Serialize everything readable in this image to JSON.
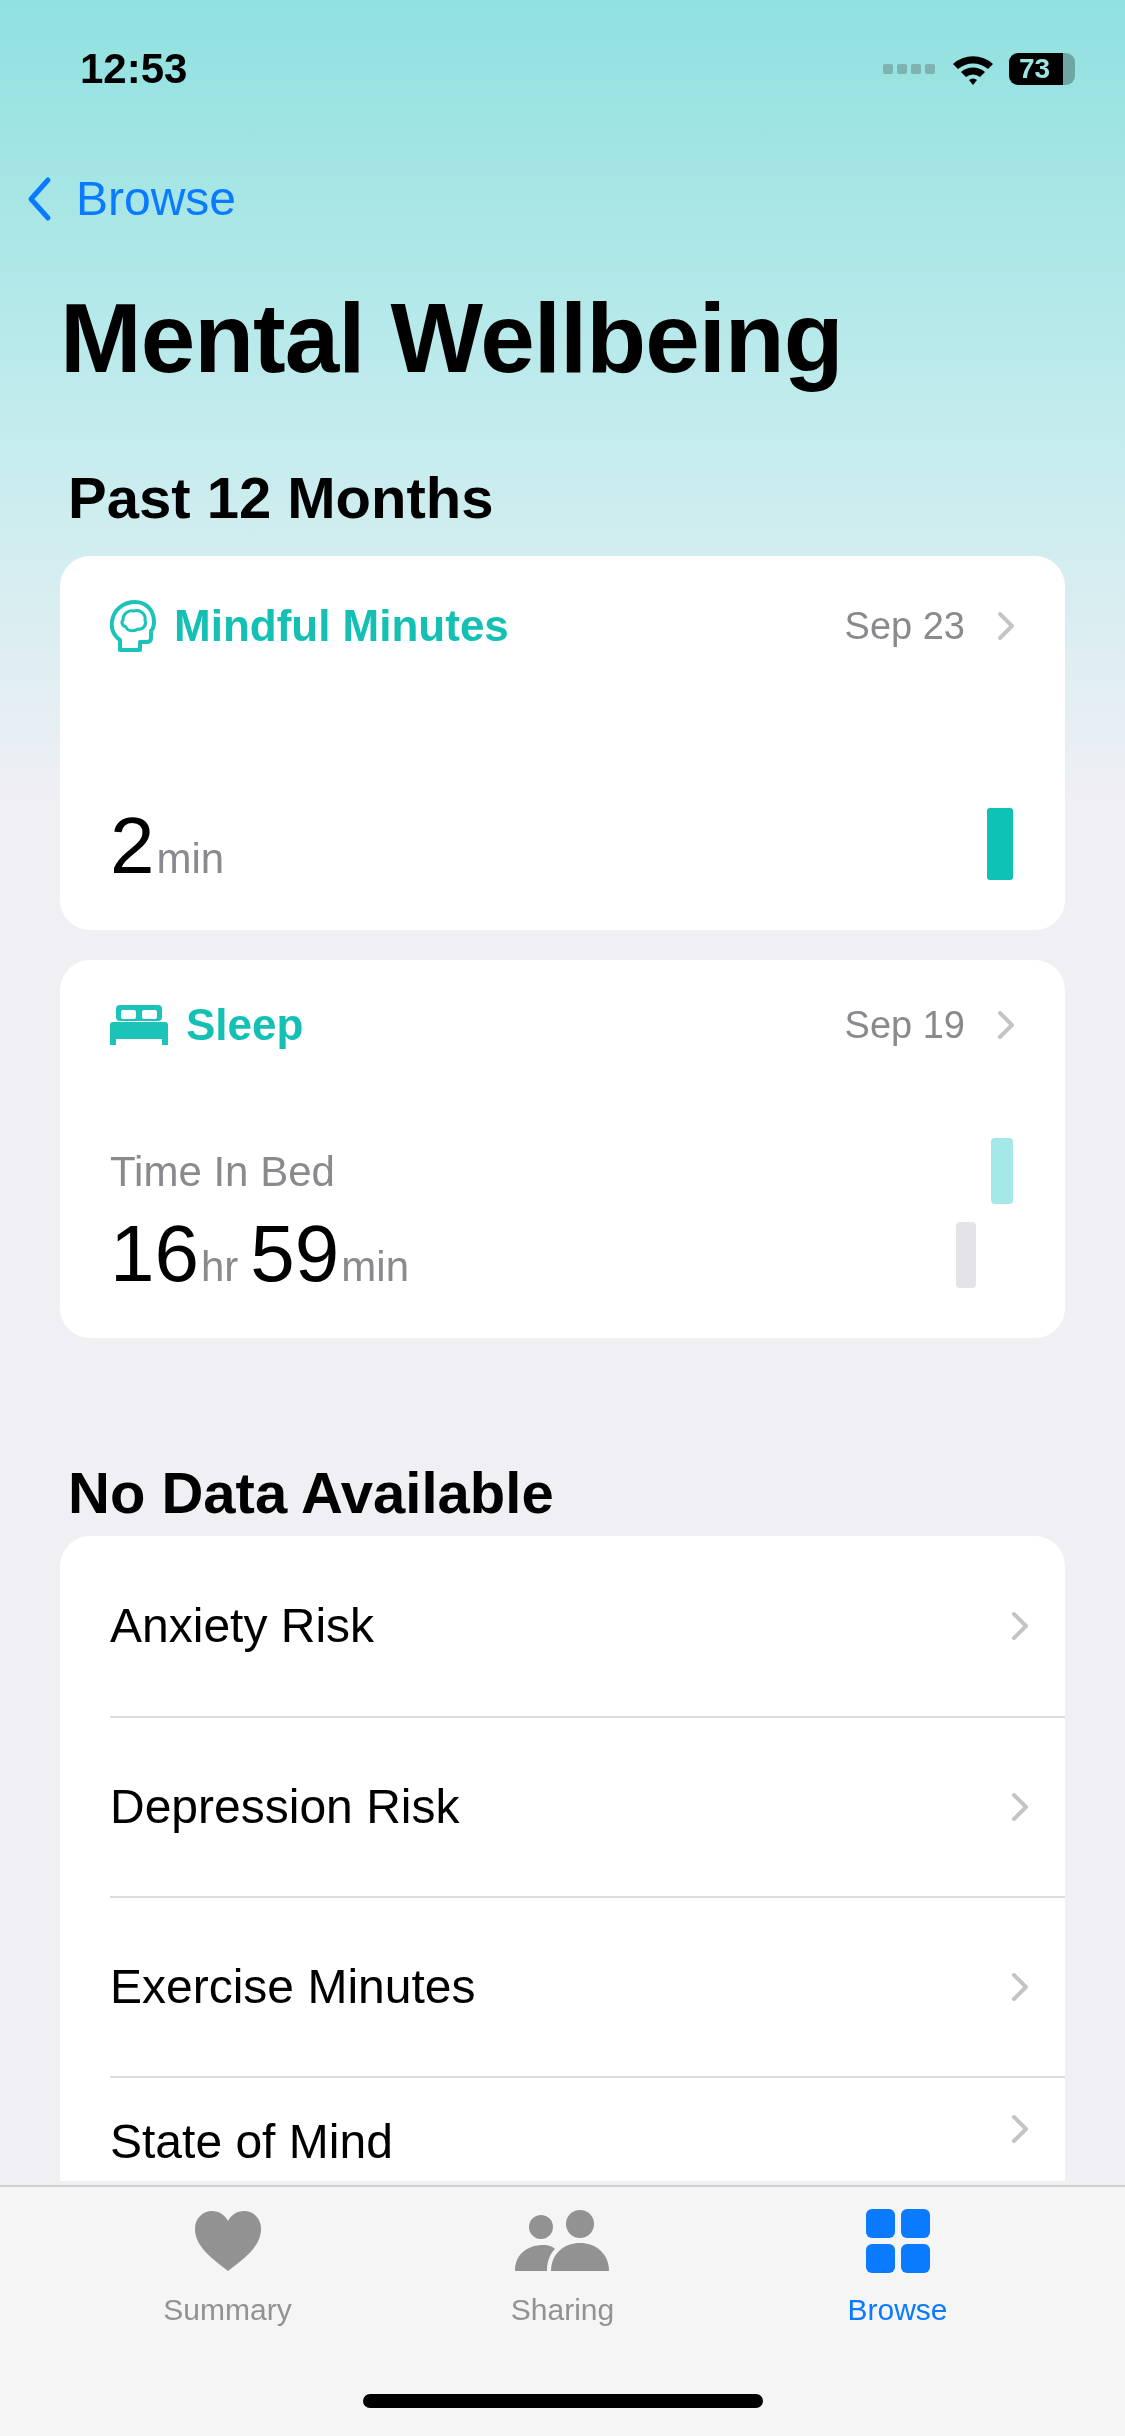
{
  "status_bar": {
    "time": "12:53",
    "battery": "73"
  },
  "nav": {
    "back_label": "Browse"
  },
  "title": "Mental Wellbeing",
  "highlights": {
    "heading": "Past 12 Months",
    "cards": [
      {
        "kind": "mindful",
        "title": "Mindful Minutes",
        "date": "Sep 23",
        "values": [
          {
            "number": "2",
            "unit": "min"
          }
        ]
      },
      {
        "kind": "sleep",
        "title": "Sleep",
        "date": "Sep 19",
        "subtitle": "Time In Bed",
        "values": [
          {
            "number": "16",
            "unit": "hr"
          },
          {
            "number": "59",
            "unit": "min"
          }
        ]
      }
    ]
  },
  "no_data": {
    "heading": "No Data Available",
    "items": [
      "Anxiety Risk",
      "Depression Risk",
      "Exercise Minutes",
      "State of Mind"
    ]
  },
  "tab_bar": [
    {
      "kind": "heart",
      "label": "Summary",
      "selected": false
    },
    {
      "kind": "people",
      "label": "Sharing",
      "selected": false
    },
    {
      "kind": "grid",
      "label": "Browse",
      "selected": true
    }
  ]
}
